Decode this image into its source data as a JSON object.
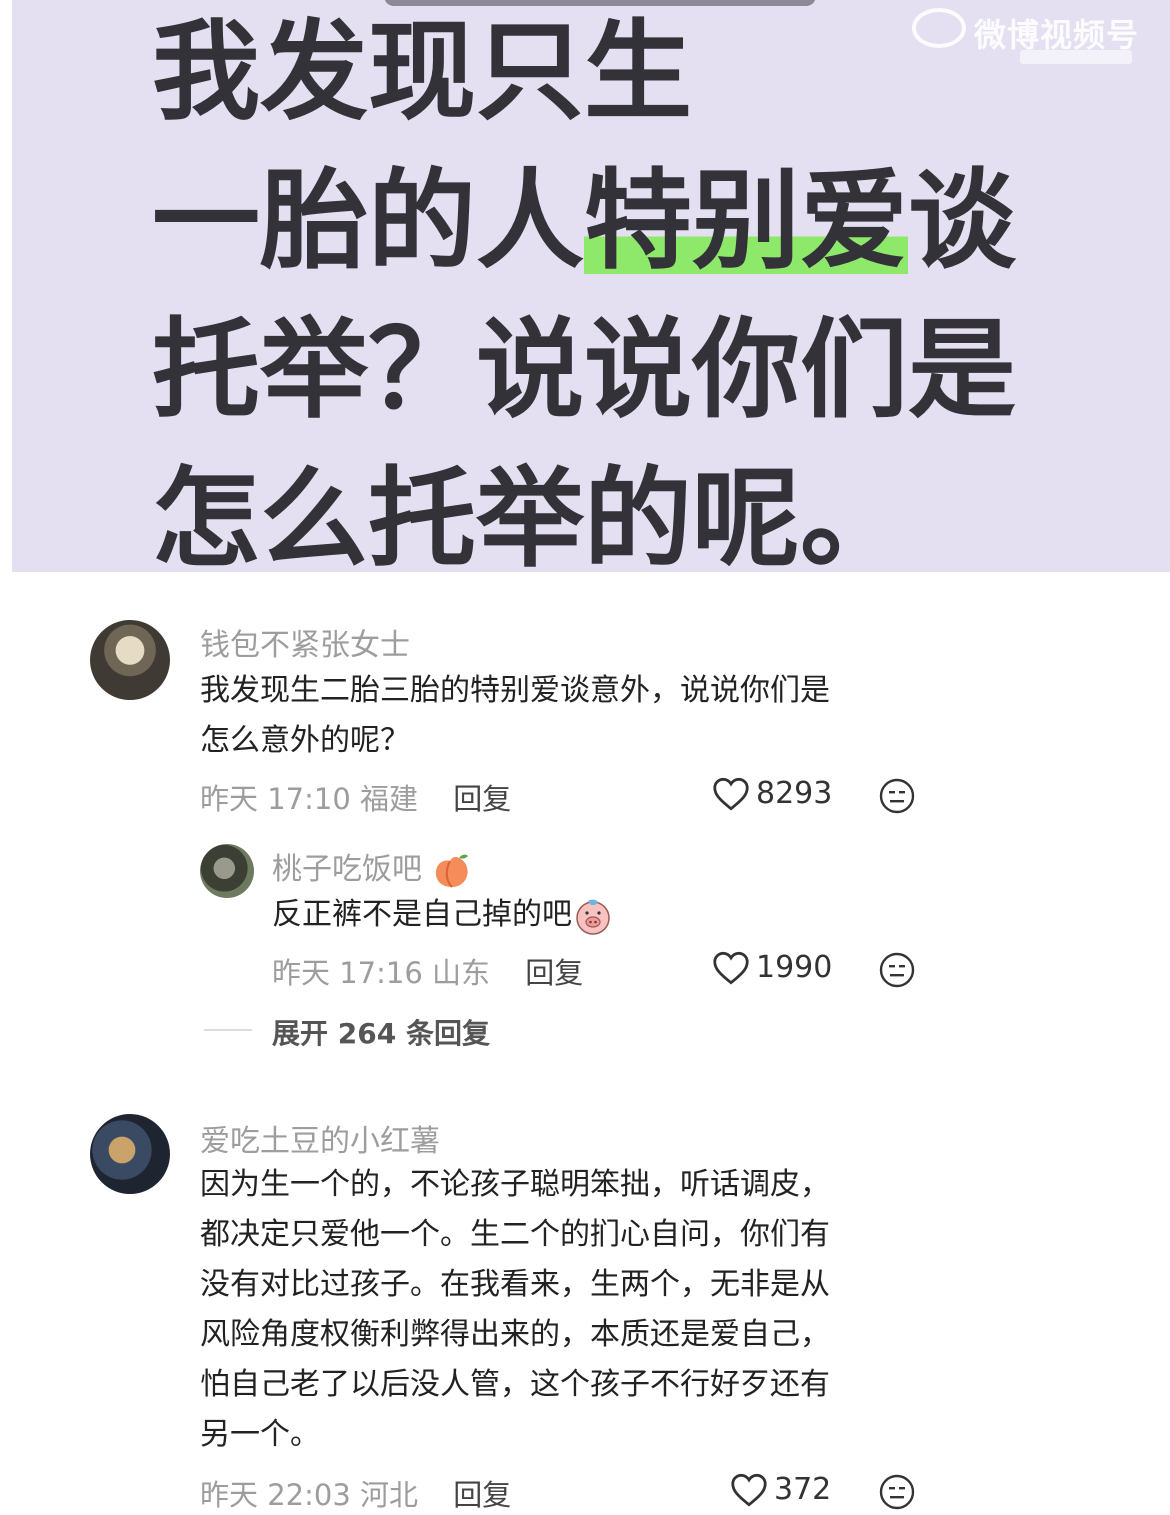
{
  "post": {
    "headline_lines": [
      "我发现只生",
      "一胎的人",
      "特别爱",
      "谈",
      "托举？说说你们是",
      "怎么托举的呢。"
    ],
    "watermark": "微博视频号"
  },
  "comments": [
    {
      "username": "钱包不紧张女士",
      "text_lines": [
        "我发现生二胎三胎的特别爱谈意外，说说你们是",
        "怎么意外的呢？"
      ],
      "time": "昨天 17:10",
      "location": "福建",
      "reply_label": "回复",
      "likes": "8293"
    },
    {
      "username": "爱吃土豆的小红薯",
      "text_lines": [
        "因为生一个的，不论孩子聪明笨拙，听话调皮，",
        "都决定只爱他一个。生二个的扪心自问，你们有",
        "没有对比过孩子。在我看来，生两个，无非是从",
        "风险角度权衡利弊得出来的，本质还是爱自己，",
        "怕自己老了以后没人管，这个孩子不行好歹还有",
        "另一个。"
      ],
      "time": "昨天 22:03",
      "location": "河北",
      "reply_label": "回复",
      "likes": "372"
    }
  ],
  "reply": {
    "username": "桃子吃饭吧",
    "username_emoji": "peach-emoji",
    "text": "反正裤不是自己掉的吧",
    "text_emoji": "pig-face-emoji",
    "time": "昨天 17:16",
    "location": "山东",
    "reply_label": "回复",
    "likes": "1990"
  },
  "expand_replies": "展开 264 条回复",
  "icons": {
    "like": "heart-icon",
    "react": "neutral-face-icon"
  },
  "colors": {
    "banner_bg": "#e4e0f1",
    "highlight": "#8ee86a"
  }
}
